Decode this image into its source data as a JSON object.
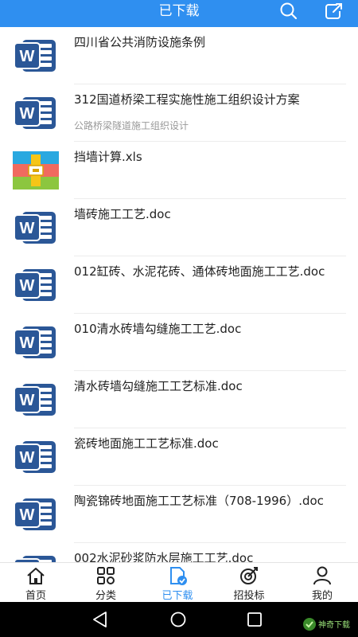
{
  "header": {
    "title": "已下载"
  },
  "files": [
    {
      "type": "word",
      "title": "四川省公共消防设施条例",
      "subtitle": ""
    },
    {
      "type": "word",
      "title": "312国道桥梁工程实施性施工组织设计方案",
      "subtitle": "公路桥梁隧道施工组织设计"
    },
    {
      "type": "archive",
      "title": "挡墙计算.xls",
      "subtitle": ""
    },
    {
      "type": "word",
      "title": "墙砖施工工艺.doc",
      "subtitle": ""
    },
    {
      "type": "word",
      "title": "012缸砖、水泥花砖、通体砖地面施工工艺.doc",
      "subtitle": ""
    },
    {
      "type": "word",
      "title": "010清水砖墙勾缝施工工艺.doc",
      "subtitle": ""
    },
    {
      "type": "word",
      "title": "清水砖墙勾缝施工工艺标准.doc",
      "subtitle": ""
    },
    {
      "type": "word",
      "title": "瓷砖地面施工工艺标准.doc",
      "subtitle": ""
    },
    {
      "type": "word",
      "title": "陶瓷锦砖地面施工工艺标准（708-1996）.doc",
      "subtitle": ""
    },
    {
      "type": "word",
      "title": "002水泥砂浆防水层施工工艺.doc",
      "subtitle": ""
    }
  ],
  "tabs": [
    {
      "label": "首页",
      "icon": "home-icon",
      "active": false
    },
    {
      "label": "分类",
      "icon": "category-icon",
      "active": false
    },
    {
      "label": "已下载",
      "icon": "downloaded-icon",
      "active": true
    },
    {
      "label": "招投标",
      "icon": "bidding-icon",
      "active": false
    },
    {
      "label": "我的",
      "icon": "profile-icon",
      "active": false
    }
  ],
  "watermark": "神奇下载",
  "colors": {
    "accent": "#2f8ff0",
    "word_icon": "#2b5797"
  }
}
